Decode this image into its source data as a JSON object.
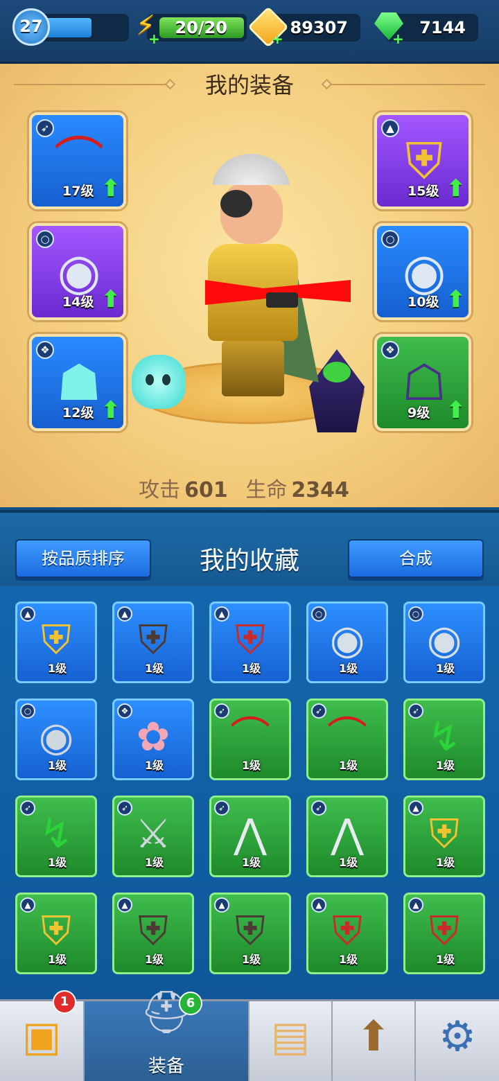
{
  "topbar": {
    "level": "27",
    "energy": "20/20",
    "gold": "89307",
    "gems": "7144"
  },
  "equipment": {
    "title": "我的装备",
    "slots_left": [
      {
        "name": "bow",
        "level": "17级",
        "rarity": "blue",
        "icon": "bow-icon",
        "type_icon": "weapon-type-icon"
      },
      {
        "name": "bear-ring",
        "level": "14级",
        "rarity": "purple",
        "icon": "bear-ring-icon",
        "type_icon": "ring-type-icon"
      },
      {
        "name": "ghost-pet",
        "level": "12级",
        "rarity": "blue",
        "icon": "ghost-icon",
        "type_icon": "pet-type-icon"
      }
    ],
    "slots_right": [
      {
        "name": "gold-armor",
        "level": "15级",
        "rarity": "purple",
        "icon": "armor-icon",
        "type_icon": "armor-type-icon"
      },
      {
        "name": "eagle-ring",
        "level": "10级",
        "rarity": "blue",
        "icon": "eagle-ring-icon",
        "type_icon": "ring-type-icon"
      },
      {
        "name": "reaper-pet",
        "level": "9级",
        "rarity": "green",
        "icon": "reaper-icon",
        "type_icon": "pet-type-icon"
      }
    ],
    "stats": {
      "attack_label": "攻击",
      "attack_value": "601",
      "hp_label": "生命",
      "hp_value": "2344"
    }
  },
  "collection": {
    "title": "我的收藏",
    "sort_label": "按品质排序",
    "merge_label": "合成",
    "items": [
      {
        "icon": "gold-armor-icon",
        "type": "armor-type-icon",
        "rarity": "blue",
        "level": "1级"
      },
      {
        "icon": "leather-vest-icon",
        "type": "armor-type-icon",
        "rarity": "blue",
        "level": "1级"
      },
      {
        "icon": "red-cape-armor-icon",
        "type": "armor-type-icon",
        "rarity": "blue",
        "level": "1级"
      },
      {
        "icon": "wolf-ring-icon",
        "type": "ring-type-icon",
        "rarity": "blue",
        "level": "1级"
      },
      {
        "icon": "wolf-ring-icon",
        "type": "ring-type-icon",
        "rarity": "blue",
        "level": "1级"
      },
      {
        "icon": "snake-ring-icon",
        "type": "ring-type-icon",
        "rarity": "blue",
        "level": "1级"
      },
      {
        "icon": "fairy-pet-icon",
        "type": "pet-type-icon",
        "rarity": "blue",
        "level": "1级"
      },
      {
        "icon": "bow-icon",
        "type": "weapon-type-icon",
        "rarity": "green",
        "level": "1级"
      },
      {
        "icon": "bow-icon",
        "type": "weapon-type-icon",
        "rarity": "green",
        "level": "1级"
      },
      {
        "icon": "scythe-icon",
        "type": "weapon-type-icon",
        "rarity": "green",
        "level": "1级"
      },
      {
        "icon": "scythe-icon",
        "type": "weapon-type-icon",
        "rarity": "green",
        "level": "1级"
      },
      {
        "icon": "sword-icon",
        "type": "weapon-type-icon",
        "rarity": "green",
        "level": "1级"
      },
      {
        "icon": "boomerang-icon",
        "type": "weapon-type-icon",
        "rarity": "green",
        "level": "1级"
      },
      {
        "icon": "boomerang-icon",
        "type": "weapon-type-icon",
        "rarity": "green",
        "level": "1级"
      },
      {
        "icon": "gold-armor-icon",
        "type": "armor-type-icon",
        "rarity": "green",
        "level": "1级"
      },
      {
        "icon": "gold-armor-icon",
        "type": "armor-type-icon",
        "rarity": "green",
        "level": "1级"
      },
      {
        "icon": "leather-vest-icon",
        "type": "armor-type-icon",
        "rarity": "green",
        "level": "1级"
      },
      {
        "icon": "leather-vest-icon",
        "type": "armor-type-icon",
        "rarity": "green",
        "level": "1级"
      },
      {
        "icon": "red-cape-armor-icon",
        "type": "armor-type-icon",
        "rarity": "green",
        "level": "1级"
      },
      {
        "icon": "red-cape-armor-icon",
        "type": "armor-type-icon",
        "rarity": "green",
        "level": "1级"
      }
    ]
  },
  "nav": {
    "items": [
      {
        "icon": "treasure-chest-icon",
        "label": "",
        "badge": "1"
      },
      {
        "icon": "equipment-helmet-icon",
        "label": "装备",
        "badge": "6"
      },
      {
        "icon": "treasure-map-icon",
        "label": "",
        "badge": ""
      },
      {
        "icon": "upgrade-arrow-icon",
        "label": "",
        "badge": ""
      },
      {
        "icon": "settings-gear-icon",
        "label": "",
        "badge": ""
      }
    ]
  },
  "colors": {
    "rarity_blue": "#1f7ae8",
    "rarity_purple": "#8a3ee8",
    "rarity_green": "#2aa33a",
    "panel_gold": "#f3cd7c"
  }
}
